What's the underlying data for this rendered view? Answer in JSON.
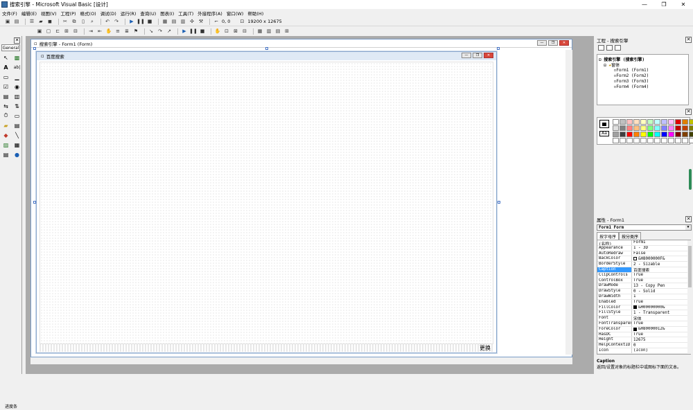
{
  "window": {
    "title": "搜索引擎 - Microsoft Visual Basic [设计]",
    "controls": [
      "—",
      "❐",
      "✕"
    ]
  },
  "menu": [
    "文件(F)",
    "编辑(E)",
    "视图(V)",
    "工程(P)",
    "格式(O)",
    "调试(D)",
    "运行(R)",
    "查询(U)",
    "图表(I)",
    "工具(T)",
    "外接程序(A)",
    "窗口(W)",
    "帮助(H)"
  ],
  "toolbar": {
    "position": "0, 0",
    "size": "19200 x 12675"
  },
  "toolbox": {
    "tab": "General",
    "status_label": "进度条"
  },
  "designer": {
    "title": "搜索引擎 - Form1 (Form)"
  },
  "form1": {
    "caption": "百度搜索",
    "footer_text": "更换"
  },
  "project": {
    "title": "工程 - 搜索引擎",
    "root": "搜索引擎 (搜索引擎)",
    "folder": "窗体",
    "forms": [
      "Form1 (Form1)",
      "Form2 (Form2)",
      "Form3 (Form3)",
      "Form4 (Form4)"
    ]
  },
  "palette": {
    "aa_label": "Aa",
    "colors": [
      "#ffffff",
      "#c0c0c0",
      "#ffc0c0",
      "#ffe0c0",
      "#ffffc0",
      "#c0ffc0",
      "#c0ffff",
      "#c0c0ff",
      "#ffc0ff",
      "#e00000",
      "#e08000",
      "#c0c000",
      "#00c000",
      "#e0e0e0",
      "#808080",
      "#ff8080",
      "#ffc080",
      "#ffff80",
      "#80ff80",
      "#80ffff",
      "#8080ff",
      "#ff80ff",
      "#c00000",
      "#c04000",
      "#808000",
      "#008000",
      "#a0a0a0",
      "#404040",
      "#ff0000",
      "#ff8000",
      "#ffff00",
      "#00ff00",
      "#00ffff",
      "#0000ff",
      "#ff00ff",
      "#800000",
      "#804000",
      "#404000",
      "#004000",
      "#ffffff",
      "#ffffff",
      "#ffffff",
      "#ffffff",
      "#ffffff",
      "#ffffff",
      "#ffffff",
      "#ffffff",
      "#ffffff",
      "#ffffff",
      "#ffffff",
      "#ffffff",
      "#ffffff"
    ]
  },
  "properties": {
    "title": "属性 - Form1",
    "object": "Form1 Form",
    "tabs": [
      "按字母序",
      "按分类序"
    ],
    "rows": [
      {
        "name": "(名称)",
        "value": "Form1"
      },
      {
        "name": "Appearance",
        "value": "1 - 3D"
      },
      {
        "name": "AutoRedraw",
        "value": "False"
      },
      {
        "name": "BackColor",
        "value": "&H8000000F&",
        "chip": "#f0f0f0"
      },
      {
        "name": "BorderStyle",
        "value": "2 - Sizable"
      },
      {
        "name": "Caption",
        "value": "百度搜索",
        "selected": true
      },
      {
        "name": "ClipControls",
        "value": "True"
      },
      {
        "name": "ControlBox",
        "value": "True"
      },
      {
        "name": "DrawMode",
        "value": "13 - Copy Pen"
      },
      {
        "name": "DrawStyle",
        "value": "0 - Solid"
      },
      {
        "name": "DrawWidth",
        "value": "1"
      },
      {
        "name": "Enabled",
        "value": "True"
      },
      {
        "name": "FillColor",
        "value": "&H00000000&",
        "chip": "#000000"
      },
      {
        "name": "FillStyle",
        "value": "1 - Transparent"
      },
      {
        "name": "Font",
        "value": "宋体"
      },
      {
        "name": "FontTransparent",
        "value": "True"
      },
      {
        "name": "ForeColor",
        "value": "&H80000012&",
        "chip": "#000000"
      },
      {
        "name": "HasDC",
        "value": "True"
      },
      {
        "name": "Height",
        "value": "12675"
      },
      {
        "name": "HelpContextID",
        "value": "0"
      },
      {
        "name": "Icon",
        "value": "(Icon)"
      }
    ],
    "desc_title": "Caption",
    "desc_text": "返回/设置对象的标题栏中或图标下面的文本。"
  }
}
